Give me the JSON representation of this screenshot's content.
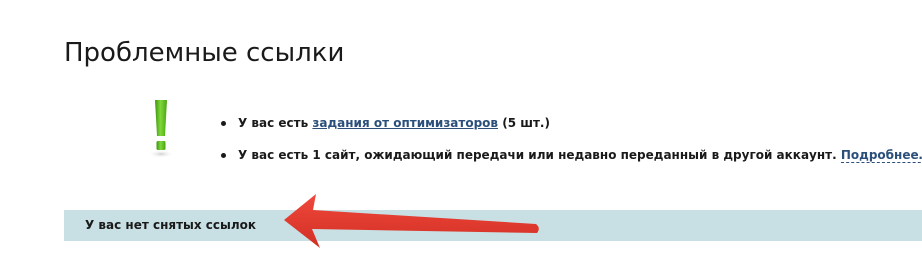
{
  "page": {
    "title": "Проблемные ссылки"
  },
  "icons": {
    "warning": "exclamation-icon",
    "annotation": "arrow-annotation",
    "warning_color": "#5bb318"
  },
  "notices": [
    {
      "prefix": "У вас есть ",
      "link": "задания от оптимизаторов",
      "suffix": " (5 шт.)"
    },
    {
      "prefix": "У вас есть 1 сайт, ожидающий передачи или недавно переданный в другой аккаунт. ",
      "link": "Подробнее…",
      "suffix": ""
    }
  ],
  "status": {
    "text": "У вас нет снятых ссылок",
    "background": "#c8dfe4"
  },
  "colors": {
    "link": "#2b4f7a",
    "arrow": "#e23b30"
  }
}
